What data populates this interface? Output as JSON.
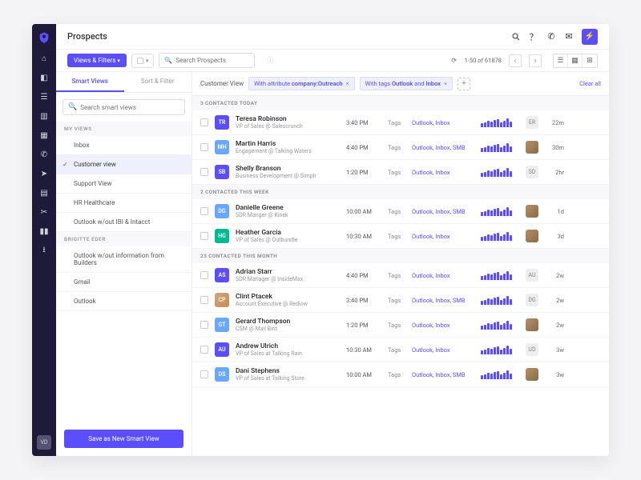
{
  "page_title": "Prospects",
  "toolbar": {
    "views_filters": "Views & Filters",
    "search_placeholder": "Search Prospects",
    "pager": "1-50 of 61878"
  },
  "panel": {
    "tabs": {
      "smart_views": "Smart Views",
      "sort_filter": "Sort & Filter"
    },
    "search_placeholder": "Search smart views",
    "sections": {
      "my_views": {
        "header": "My Views",
        "items": [
          "Inbox",
          "Customer view",
          "Support View",
          "HR Healthcare",
          "Outlook w/out IBI & Intacct"
        ],
        "selected": 1
      },
      "user_views": {
        "header": "Brigitte Eder",
        "items": [
          "Outlook w/out information from Builders",
          "Gmail",
          "Outlook"
        ]
      }
    },
    "save_button": "Save as New Smart View"
  },
  "filterbar": {
    "view_name": "Customer View",
    "chip1_pre": "With attribute ",
    "chip1_b": "company:Outreach",
    "chip2_pre": "With tags ",
    "chip2_b1": "Outlook",
    "chip2_mid": " and ",
    "chip2_b2": "Inbox",
    "clear_all": "Clear all"
  },
  "groups": [
    {
      "header": "3 Contacted Today",
      "rows": [
        {
          "initials": "TR",
          "color": "#5b4eff",
          "name": "Teresa Robinson",
          "role": "VP of Sales @ Salescrunch",
          "time": "3:40 PM",
          "tags": "Outlook, Inbox",
          "owner": "ER",
          "owner_img": false,
          "age": "22m"
        },
        {
          "initials": "MH",
          "color": "#6aa7ff",
          "name": "Martin Harris",
          "role": "Engagement @ Talking Waters",
          "time": "4:40 PM",
          "tags": "Outlook, Inbox, SMB",
          "owner": "",
          "owner_img": true,
          "age": "30m"
        },
        {
          "initials": "SB",
          "color": "#5b4eff",
          "name": "Shelly Branson",
          "role": "Business Development @ Simplr",
          "time": "1:20 PM",
          "tags": "Outlook, Inbox",
          "owner": "SD",
          "owner_img": false,
          "age": "2hr"
        }
      ]
    },
    {
      "header": "2 Contacted This Week",
      "rows": [
        {
          "initials": "DG",
          "color": "#6aa7ff",
          "name": "Danielle Greene",
          "role": "SDR Manger @ Kinek",
          "time": "10:00 AM",
          "tags": "Outlook, Inbox, SMB",
          "owner": "",
          "owner_img": true,
          "age": "1d"
        },
        {
          "initials": "HG",
          "color": "#00b894",
          "name": "Heather Garcia",
          "role": "VP of Sales @ Outbundle",
          "time": "10:30 AM",
          "tags": "Outlook, Inbox",
          "owner": "",
          "owner_img": true,
          "age": "3d"
        }
      ]
    },
    {
      "header": "23 Contacted This Month",
      "rows": [
        {
          "initials": "AS",
          "color": "#5b4eff",
          "name": "Adrian Starr",
          "role": "SDR Manager @ InsideMax",
          "time": "4:40 PM",
          "tags": "Outlook, Inbox",
          "owner": "AU",
          "owner_img": false,
          "age": "2w"
        },
        {
          "initials": "CP",
          "color": "",
          "img": true,
          "name": "Clint Ptacek",
          "role": "Account Executive @ Redlow",
          "time": "3:40 PM",
          "tags": "Outlook, Inbox, SMB",
          "owner": "DG",
          "owner_img": false,
          "age": "2w"
        },
        {
          "initials": "GT",
          "color": "#6aa7ff",
          "name": "Gerard Thompson",
          "role": "CSM @ Mail Bird",
          "time": "1:20 PM",
          "tags": "Outlook, Inbox",
          "owner": "",
          "owner_img": true,
          "age": "2w"
        },
        {
          "initials": "AU",
          "color": "#5b4eff",
          "name": "Andrew Ulrich",
          "role": "VP of Sales at Talking Rain",
          "time": "10:30 AM",
          "tags": "Outlook, Inbox",
          "owner": "UD",
          "owner_img": false,
          "age": "3w"
        },
        {
          "initials": "DS",
          "color": "#6aa7ff",
          "name": "Dani Stephens",
          "role": "VP of Sales at Talking Store",
          "time": "10:00 AM",
          "tags": "Outlook, Inbox, SMB",
          "owner": "",
          "owner_img": true,
          "age": "3w"
        }
      ]
    }
  ],
  "tags_label": "Tags",
  "rail_badge": "VD"
}
